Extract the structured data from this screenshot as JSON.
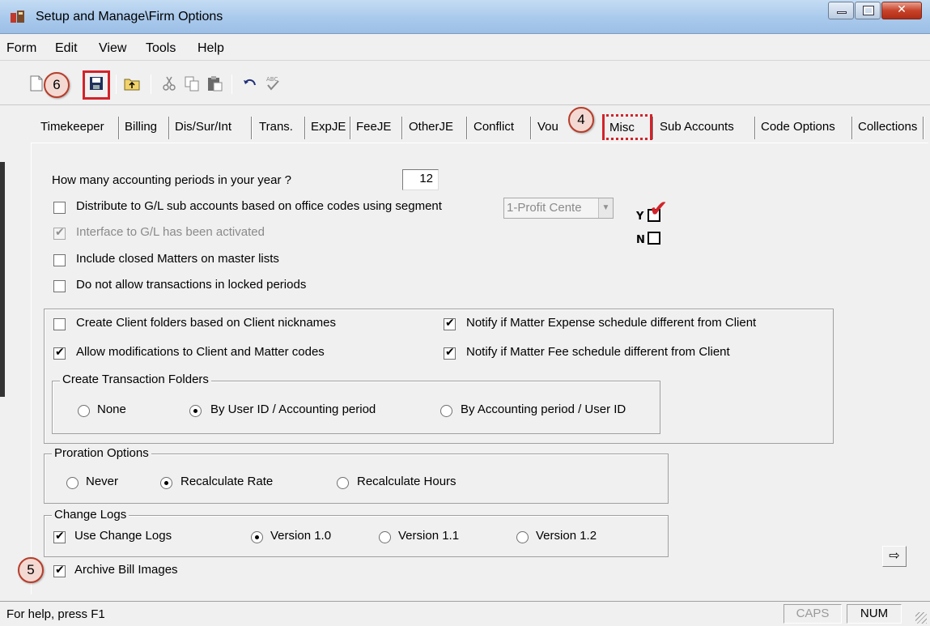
{
  "window": {
    "title": "Setup and Manage\\Firm Options"
  },
  "menu": [
    "Form",
    "Edit",
    "View",
    "Tools",
    "Help"
  ],
  "callouts": {
    "save": "6",
    "misc_tab": "4",
    "archive": "5"
  },
  "tabs": [
    "Timekeeper",
    "Billing",
    "Dis/Sur/Int",
    "Trans.",
    "ExpJE",
    "FeeJE",
    "OtherJE",
    "Conflict",
    "Vou",
    "Misc",
    "Sub Accounts",
    "Code Options",
    "Collections"
  ],
  "active_tab": "Misc",
  "misc": {
    "periods_label": "How many accounting periods in your year ?",
    "periods_value": "12",
    "distribute_label": "Distribute to G/L sub accounts based on office codes using segment",
    "distribute_checked": false,
    "segment_value": "1-Profit Cente",
    "interface_label": "Interface to G/L has been activated",
    "interface_checked": true,
    "include_closed_label": "Include closed Matters on master lists",
    "include_closed_checked": false,
    "locked_periods_label": "Do not allow transactions in locked periods",
    "locked_periods_checked": false,
    "legend_y": "Y",
    "legend_n": "N"
  },
  "client_group": {
    "client_folders_label": "Create Client folders based on Client nicknames",
    "client_folders_checked": false,
    "allow_mod_label": "Allow modifications to Client and Matter codes",
    "allow_mod_checked": true,
    "notify_expense_label": "Notify if Matter Expense schedule different from Client",
    "notify_expense_checked": true,
    "notify_fee_label": "Notify if Matter Fee schedule different from Client",
    "notify_fee_checked": true
  },
  "transaction_folders": {
    "title": "Create Transaction Folders",
    "options": [
      "None",
      "By User ID / Accounting period",
      "By Accounting period / User ID"
    ],
    "selected": "By User ID / Accounting period"
  },
  "proration": {
    "title": "Proration Options",
    "options": [
      "Never",
      "Recalculate Rate",
      "Recalculate Hours"
    ],
    "selected": "Recalculate Rate"
  },
  "change_logs": {
    "title": "Change Logs",
    "use_label": "Use Change Logs",
    "use_checked": true,
    "versions": [
      "Version 1.0",
      "Version 1.1",
      "Version 1.2"
    ],
    "selected": "Version 1.0"
  },
  "archive": {
    "label": "Archive Bill Images",
    "checked": true
  },
  "status": {
    "help": "For help, press F1",
    "caps": "CAPS",
    "num": "NUM"
  },
  "icons": {
    "app": "app-icon",
    "new": "new-document-icon",
    "save": "save-icon",
    "print": "print-icon",
    "folder_up": "folder-up-icon",
    "cut": "cut-icon",
    "copy": "copy-icon",
    "paste": "paste-icon",
    "undo": "undo-icon",
    "spell": "spellcheck-icon",
    "next": "arrow-right-icon"
  },
  "colors": {
    "highlight": "#d2232a",
    "callout_fill": "#f4d9d2",
    "titlebar": "#a9c9ec"
  }
}
